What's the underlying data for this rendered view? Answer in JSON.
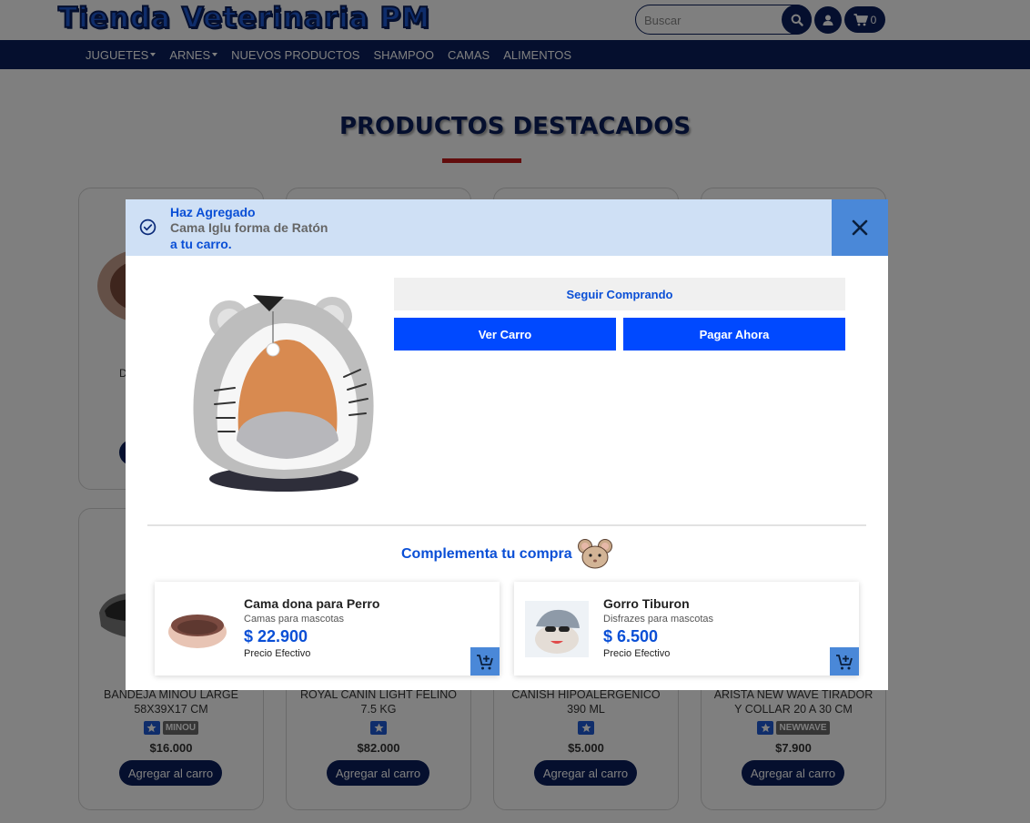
{
  "header": {
    "logo_text": "Tienda Veterinaria PM",
    "search_placeholder": "Buscar",
    "cart_count": "0"
  },
  "nav": {
    "items": [
      {
        "label": "JUGUETES",
        "dropdown": true
      },
      {
        "label": "ARNES",
        "dropdown": true
      },
      {
        "label": "NUEVOS PRODUCTOS",
        "dropdown": false
      },
      {
        "label": "SHAMPOO",
        "dropdown": false
      },
      {
        "label": "CAMAS",
        "dropdown": false
      },
      {
        "label": "ALIMENTOS",
        "dropdown": false
      }
    ]
  },
  "page": {
    "section_title": "PRODUCTOS DESTACADOS",
    "partial_card_letter": "D",
    "products": [
      {
        "name_l1": "BANDEJA MINOU LARGE",
        "name_l2": "58X39X17 CM",
        "brand": "MINOU",
        "price": "$16.000",
        "button": "Agregar al carro"
      },
      {
        "name_l1": "ROYAL CANIN LIGHT FELINO",
        "name_l2": "7.5 KG",
        "brand": "",
        "price": "$82.000",
        "button": "Agregar al carro"
      },
      {
        "name_l1": "CANISH HIPOALERGENICO",
        "name_l2": "390 ML",
        "brand": "",
        "price": "$5.000",
        "button": "Agregar al carro"
      },
      {
        "name_l1": "ARISTA NEW WAVE TIRADOR",
        "name_l2": "Y COLLAR 20 A 30 CM",
        "brand": "NEWWAVE",
        "price": "$7.900",
        "button": "Agregar al carro"
      }
    ]
  },
  "modal": {
    "added_line1": "Haz Agregado",
    "product_name": "Cama Iglu forma de Ratón",
    "added_line3": "a tu carro.",
    "keep_shopping": "Seguir Comprando",
    "view_cart": "Ver Carro",
    "pay_now": "Pagar Ahora",
    "complement_title": "Complementa tu compra",
    "recommendations": [
      {
        "name": "Cama dona para Perro",
        "category": "Camas para mascotas",
        "price": "$ 22.900",
        "note": "Precio Efectivo"
      },
      {
        "name": "Gorro Tiburon",
        "category": "Disfrazes para mascotas",
        "price": "$ 6.500",
        "note": "Precio Efectivo"
      }
    ]
  },
  "colors": {
    "navy": "#0a1f5c",
    "accent_blue": "#0049ff",
    "link_blue": "#0a4fd6",
    "header_bg": "#cfe0f5",
    "close_bg": "#4a88d8",
    "underline_red": "#c41a1a"
  }
}
